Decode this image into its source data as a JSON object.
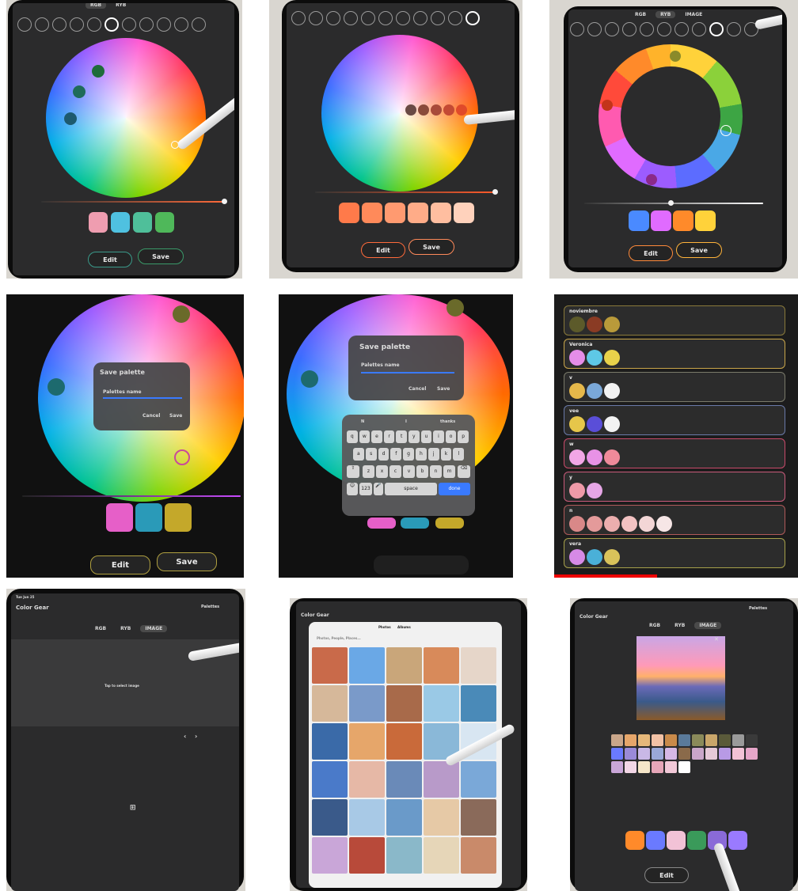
{
  "rgb_tab": "RGB",
  "ryb_tab": "RYB",
  "image_tab": "IMAGE",
  "edit_label": "Edit",
  "save_label": "Save",
  "save_palette": {
    "title": "Save palette",
    "placeholder": "Palettes name",
    "cancel": "Cancel",
    "save": "Save"
  },
  "keyboard": {
    "suggestions": [
      "N",
      "I",
      "thanks"
    ],
    "row1": [
      "q",
      "w",
      "e",
      "r",
      "t",
      "y",
      "u",
      "i",
      "o",
      "p"
    ],
    "row2": [
      "a",
      "s",
      "d",
      "f",
      "g",
      "h",
      "j",
      "k",
      "l"
    ],
    "row3": [
      "z",
      "x",
      "c",
      "v",
      "b",
      "n",
      "m"
    ],
    "numbers_key": "123",
    "space_key": "space",
    "done_key": "done"
  },
  "palettes": [
    {
      "name": "noviembre",
      "colors": [
        "#5c5a2a",
        "#8a3b24",
        "#b99a3a"
      ],
      "border": "#8a7a3a"
    },
    {
      "name": "Veronica",
      "colors": [
        "#e58de8",
        "#5ec8e6",
        "#e9d24a"
      ],
      "border": "#c9a64a"
    },
    {
      "name": "v",
      "colors": [
        "#e6b84a",
        "#7aa8d8",
        "#f2f2f2"
      ],
      "border": "#7a7a6a"
    },
    {
      "name": "vee",
      "colors": [
        "#e6c64a",
        "#5a4ed8",
        "#f2f2f2"
      ],
      "border": "#6a7aa8"
    },
    {
      "name": "w",
      "colors": [
        "#f2a6e6",
        "#e892e6",
        "#ef8a9a"
      ],
      "border": "#c94a6a"
    },
    {
      "name": "y",
      "colors": [
        "#ef9aa8",
        "#e6a6e6"
      ],
      "border": "#c95a7a"
    },
    {
      "name": "n",
      "colors": [
        "#d98888",
        "#e49a9a",
        "#ecaeae",
        "#f2c2c2",
        "#f3d6d6",
        "#f6e6e6"
      ],
      "border": "#b05a5a"
    },
    {
      "name": "vera",
      "colors": [
        "#d68ae6",
        "#4ab0d8",
        "#d9c25a"
      ],
      "border": "#a6a04a"
    }
  ],
  "statusbar": {
    "left": "Tue Jun 25",
    "right": "Palettes"
  },
  "app_title": "Color Gear",
  "image_prompt": "Tap to select image",
  "photo_picker": {
    "tab_photos": "Photos",
    "tab_albums": "Albums",
    "search": "Photos, People, Places..."
  },
  "accent": "#ff5a2a"
}
